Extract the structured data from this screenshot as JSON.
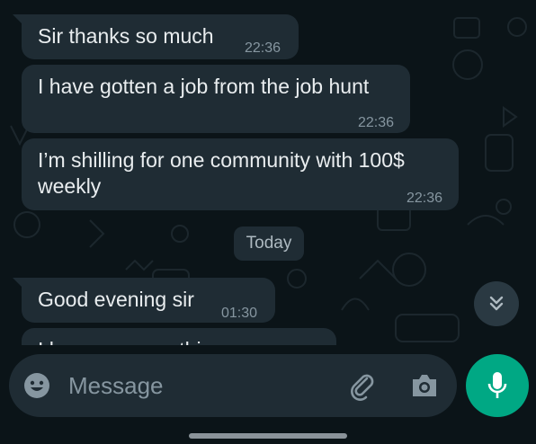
{
  "messages": [
    {
      "text": "Sir thanks so much",
      "time": "22:36"
    },
    {
      "text": "I have gotten a job from the job hunt",
      "time": "22:36"
    },
    {
      "text_line1": "I’m shilling for one community with 100$",
      "text_line2": "weekly",
      "time": "22:36"
    }
  ],
  "date_separator": "Today",
  "today_messages": [
    {
      "text": "Good evening sir",
      "time": "01:30"
    },
    {
      "text": "I hope you see this one"
    }
  ],
  "input": {
    "placeholder": "Message"
  },
  "colors": {
    "background": "#0b1418",
    "bubble": "#1f2c34",
    "accent": "#00a884",
    "text": "#e9edef",
    "meta": "#8696a0"
  }
}
